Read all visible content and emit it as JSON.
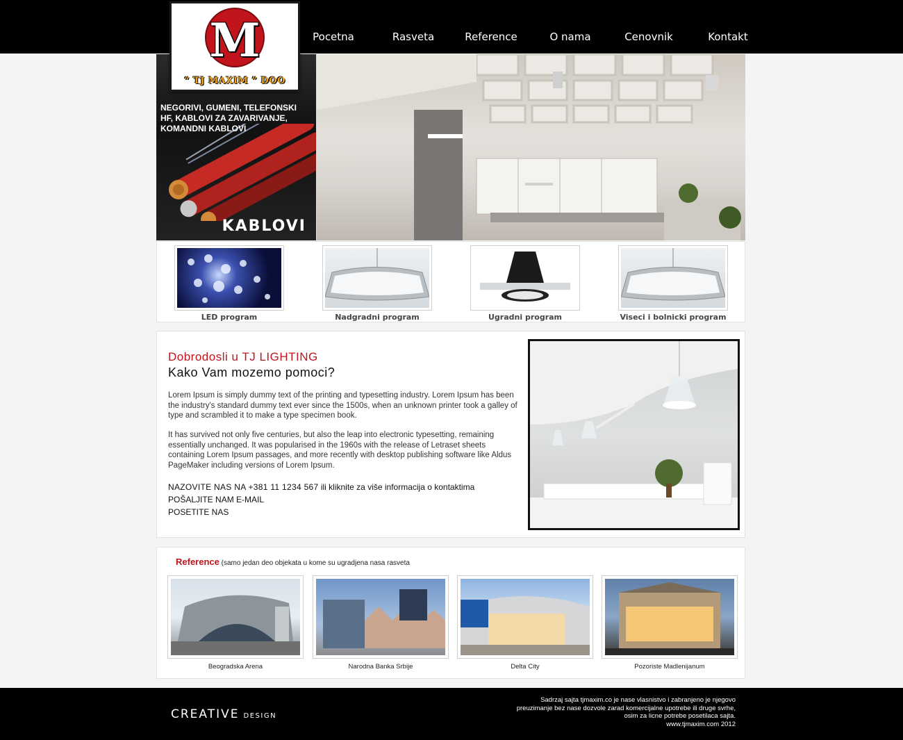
{
  "nav": {
    "items": [
      "Pocetna",
      "Rasveta",
      "Reference",
      "O nama",
      "Cenovnik",
      "Kontakt"
    ]
  },
  "logo": {
    "letter": "M",
    "text": "“ TJ MAXIM ” DOO"
  },
  "hero": {
    "caption": "NEGORIVI, GUMENI, TELEFONSKI HF, KABLOVI ZA ZAVARIVANJE, KOMANDNI KABLOVI",
    "word": "KABLOVI"
  },
  "products": [
    {
      "label": "LED program"
    },
    {
      "label": "Nadgradni program"
    },
    {
      "label": "Ugradni program"
    },
    {
      "label": "Viseci i bolnicki program"
    }
  ],
  "welcome": {
    "title": "Dobrodosli u TJ LIGHTING",
    "subtitle": "Kako Vam mozemo pomoci?",
    "p1": "Lorem Ipsum is simply dummy text of the printing and typesetting industry. Lorem Ipsum has been the industry's standard dummy text ever since the 1500s, when an unknown printer took a galley of type and scrambled it to make a type specimen book.",
    "p2": "It has survived not only five centuries, but also the leap into electronic typesetting, remaining essentially unchanged. It was popularised in the 1960s with the release of Letraset sheets containing Lorem Ipsum passages, and more recently with desktop publishing software like Aldus PageMaker including versions of Lorem Ipsum.",
    "call_label": "NAZOVITE NAS NA +381 11 1234 567",
    "call_rest": " ili kliknite za više informacija o kontaktima",
    "email": "POŠALJITE NAM E-MAIL",
    "visit": "POSETITE NAS"
  },
  "references": {
    "heading": "Reference",
    "subheading": " (samo jedan deo objekata u kome su ugradjena nasa rasveta",
    "items": [
      {
        "label": "Beogradska Arena"
      },
      {
        "label": "Narodna Banka Srbije"
      },
      {
        "label": "Delta City"
      },
      {
        "label": "Pozoriste Madlenijanum"
      }
    ]
  },
  "footer": {
    "brand": "CREATIVE",
    "brand_small": "DESIGN",
    "legal_lines": [
      "Sadrzaj sajta tjmaxim.co je nase vlasnistvo i zabranjeno je njegovo",
      "preuzimanje bez nase dozvole zarad komercijalne upotrebe ili druge svrhe,",
      "osim za licne potrebe posetilaca sajta.",
      "www.tjmaxim.com 2012"
    ]
  },
  "colors": {
    "accent_red": "#c0141c",
    "header_bg": "#000000",
    "page_bg": "#f4f4f4"
  }
}
